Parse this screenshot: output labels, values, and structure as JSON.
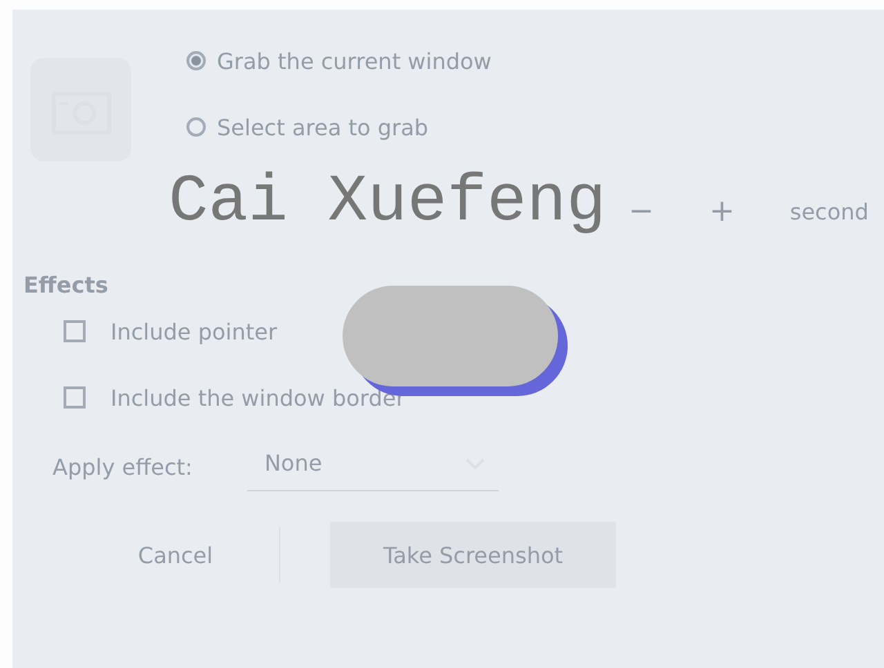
{
  "overlay": {
    "name": "Cai Xuefeng"
  },
  "capture": {
    "options": [
      {
        "label": "Grab the current window",
        "selected": true
      },
      {
        "label": "Select area to grab",
        "selected": false
      }
    ],
    "delay": {
      "decrease": "−",
      "increase": "+",
      "unit": "second"
    }
  },
  "effects": {
    "title": "Effects",
    "options": [
      {
        "label": "Include pointer",
        "checked": false
      },
      {
        "label": "Include the window border",
        "checked": false
      }
    ],
    "apply_label": "Apply effect:",
    "apply_value": "None"
  },
  "buttons": [
    {
      "label": "Cancel",
      "kind": "flat"
    },
    {
      "label": "Take Screenshot",
      "kind": "primary"
    }
  ]
}
